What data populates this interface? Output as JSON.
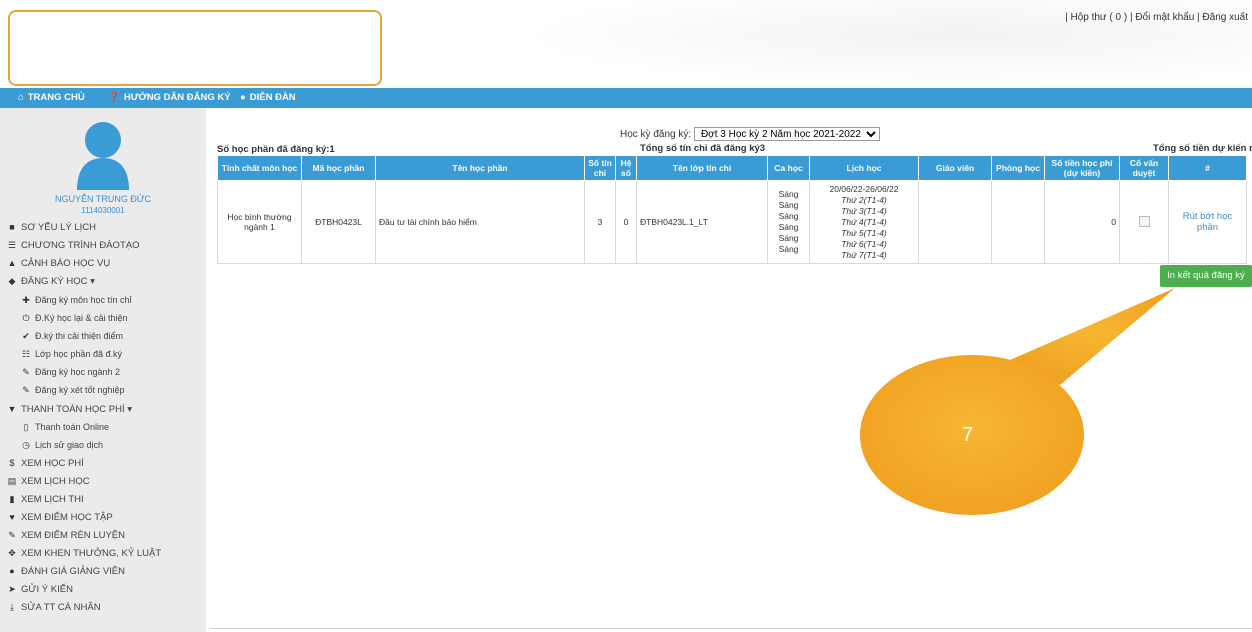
{
  "header": {
    "top_links": "| Hộp thư ( 0 ) | Đổi mật khẩu | Đăng xuất"
  },
  "nav": {
    "items": [
      {
        "icon": "home-icon",
        "label": "TRANG CHỦ"
      },
      {
        "icon": "question-circle-icon",
        "label": "HƯỚNG DẪN ĐĂNG KÝ"
      },
      {
        "icon": "user-icon",
        "label": "DIỄN ĐÀN"
      }
    ]
  },
  "sidebar": {
    "user_name": "NGUYỄN TRUNG ĐỨC",
    "user_id": "1114030001",
    "items": [
      {
        "icon": "user-icon",
        "label": "SƠ YẾU LÝ LỊCH"
      },
      {
        "icon": "list-icon",
        "label": "CHƯƠNG TRÌNH ĐÀOTẠO"
      },
      {
        "icon": "warning-icon",
        "label": "CẢNH BÁO HỌC VỤ"
      },
      {
        "icon": "tags-icon",
        "label": "ĐĂNG KÝ HỌC ▾"
      },
      {
        "icon": "plus-icon",
        "label": "Đăng ký môn học tín chỉ",
        "sub": true
      },
      {
        "icon": "power-icon",
        "label": "Đ.Ký học lại & cải thiện",
        "sub": true
      },
      {
        "icon": "check-icon",
        "label": "Đ.ký thi cải thiện điểm",
        "sub": true
      },
      {
        "icon": "th-list-icon",
        "label": "Lớp học phần đã đ.ký",
        "sub": true
      },
      {
        "icon": "pencil-icon",
        "label": "Đăng ký học ngành 2",
        "sub": true
      },
      {
        "icon": "pencil-icon",
        "label": "Đăng ký xét tốt nghiệp",
        "sub": true
      },
      {
        "icon": "cart-icon",
        "label": "THANH TOÁN HỌC PHÍ ▾"
      },
      {
        "icon": "mobile-icon",
        "label": "Thanh toán Online",
        "sub": true
      },
      {
        "icon": "clock-icon",
        "label": "Lịch sử giao dịch",
        "sub": true
      },
      {
        "icon": "dollar-icon",
        "label": "XEM HỌC PHÍ"
      },
      {
        "icon": "calendar-list-icon",
        "label": "XEM LỊCH HỌC"
      },
      {
        "icon": "file-icon",
        "label": "XEM LỊCH THI"
      },
      {
        "icon": "heart-icon",
        "label": "XEM ĐIỂM HỌC TẬP"
      },
      {
        "icon": "pencil-icon",
        "label": "XEM ĐIỂM RÈN LUYỆN"
      },
      {
        "icon": "move-icon",
        "label": "XEM KHEN THƯỞNG, KỶ LUẬT"
      },
      {
        "icon": "ok-circle-icon",
        "label": "ĐÁNH GIÁ GIẢNG VIÊN"
      },
      {
        "icon": "send-icon",
        "label": "GỬI Ý KIẾN"
      },
      {
        "icon": "download-icon",
        "label": "SỬA TT CÁ NHÂN"
      }
    ]
  },
  "main": {
    "semester_label": "Học kỳ đăng ký:",
    "semester_selected": "Đợt 3 Học kỳ 2 Năm học 2021-2022",
    "registered_count_text": "Số học phần đã đăng ký:1",
    "credit_total_text": "Tổng số tín chỉ đã đăng ký3",
    "fee_total_text": "Tổng số tiền dự kiến nộp",
    "table": {
      "headers": [
        "Tính chất môn học",
        "Mã học phần",
        "Tên học phần",
        "Số tín chỉ",
        "Hệ số",
        "Tên lớp tín chỉ",
        "Ca học",
        "Lịch học",
        "Giáo viên",
        "Phòng học",
        "Số tiền học phí (dự kiến)",
        "Cố vấn duyệt",
        "#"
      ],
      "row": {
        "type": "Học bình thường ngành 1",
        "code": "ĐTBH0423L",
        "name": "Đầu tư tài chính bảo hiểm",
        "credits": "3",
        "coef": "0",
        "class": "ĐTBH0423L.1_LT",
        "shifts": [
          "Sáng",
          "Sáng",
          "Sáng",
          "Sáng",
          "Sáng",
          "Sáng"
        ],
        "schedule_range": "20/06/22-26/06/22",
        "schedule": [
          "Thứ 2(T1-4)",
          "Thứ 3(T1-4)",
          "Thứ 4(T1-4)",
          "Thứ 5(T1-4)",
          "Thứ 6(T1-4)",
          "Thứ 7(T1-4)"
        ],
        "teacher": "",
        "room": "",
        "fee": "0",
        "action": "Rút bớt học phần"
      }
    },
    "print_button": "In kết quả đăng ký",
    "callout_number": "7"
  },
  "colors": {
    "nav_bg": "#3a9bd5",
    "print_button": "#4cae4c",
    "callout": "#f5a623",
    "logo_border": "#e8a33c"
  }
}
